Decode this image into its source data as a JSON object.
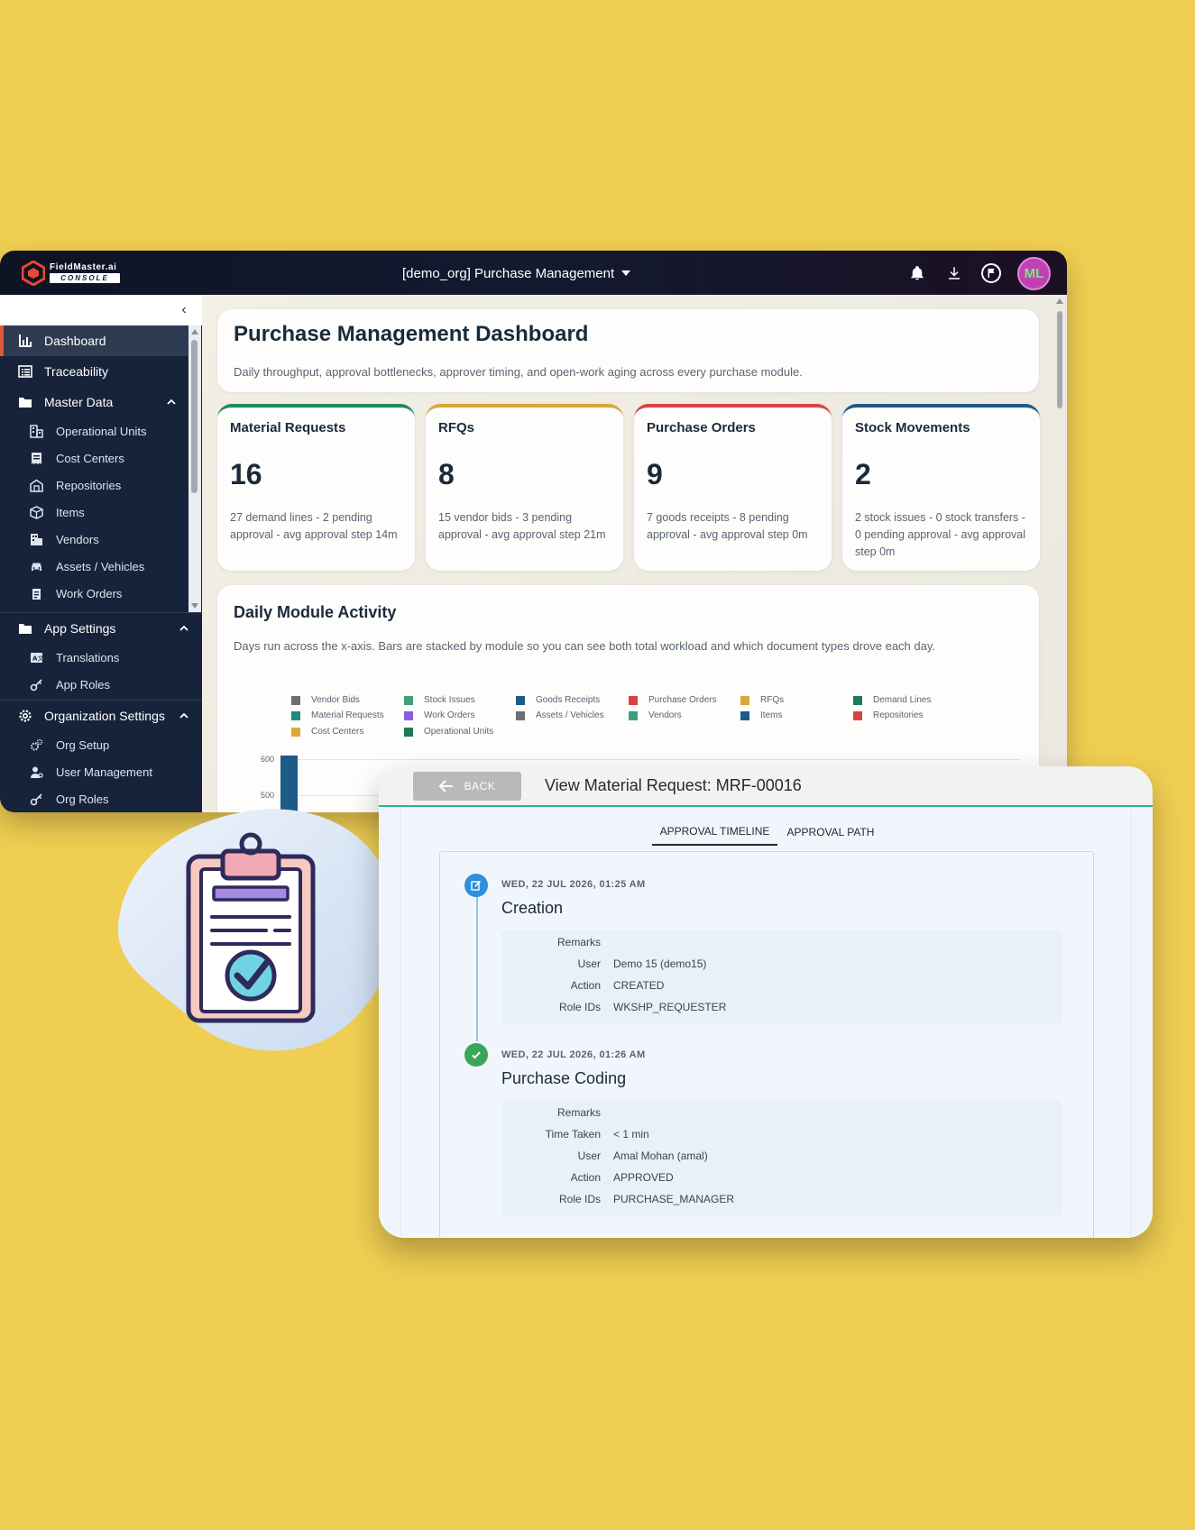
{
  "app": {
    "brand_line1": "FieldMaster.ai",
    "brand_line2": "CONSOLE",
    "module_selector": "[demo_org] Purchase Management",
    "user_initials": "ML"
  },
  "sidebar": {
    "items": [
      {
        "label": "Dashboard"
      },
      {
        "label": "Traceability"
      },
      {
        "label": "Master Data"
      }
    ],
    "master_data": [
      {
        "label": "Operational Units"
      },
      {
        "label": "Cost Centers"
      },
      {
        "label": "Repositories"
      },
      {
        "label": "Items"
      },
      {
        "label": "Vendors"
      },
      {
        "label": "Assets / Vehicles"
      },
      {
        "label": "Work Orders"
      }
    ],
    "app_settings": {
      "label": "App Settings",
      "items": [
        {
          "label": "Translations"
        },
        {
          "label": "App Roles"
        }
      ]
    },
    "org_settings": {
      "label": "Organization Settings",
      "items": [
        {
          "label": "Org Setup"
        },
        {
          "label": "User Management"
        },
        {
          "label": "Org Roles"
        }
      ]
    }
  },
  "dashboard": {
    "title": "Purchase Management Dashboard",
    "subtitle": "Daily throughput, approval bottlenecks, approver timing, and open-work aging across every purchase module.",
    "cards": [
      {
        "title": "Material Requests",
        "value": "16",
        "desc": "27 demand lines - 2 pending approval - avg approval step 14m",
        "color": "#1f8a66"
      },
      {
        "title": "RFQs",
        "value": "8",
        "desc": "15 vendor bids - 3 pending approval - avg approval step 21m",
        "color": "#d9a83a"
      },
      {
        "title": "Purchase Orders",
        "value": "9",
        "desc": "7 goods receipts - 8 pending approval - avg approval step 0m",
        "color": "#d64541"
      },
      {
        "title": "Stock Movements",
        "value": "2",
        "desc": "2 stock issues - 0 stock transfers - 0 pending approval - avg approval step 0m",
        "color": "#1c5b86"
      }
    ],
    "activity": {
      "title": "Daily Module Activity",
      "subtitle": "Days run across the x-axis. Bars are stacked by module so you can see both total workload and which document types drove each day."
    }
  },
  "chart_data": {
    "type": "bar",
    "stacked": true,
    "legend": [
      {
        "name": "Vendor Bids",
        "color": "#6b6f76"
      },
      {
        "name": "Stock Issues",
        "color": "#3fa07a"
      },
      {
        "name": "Goods Receipts",
        "color": "#1c5b86"
      },
      {
        "name": "Purchase Orders",
        "color": "#d64541"
      },
      {
        "name": "RFQs",
        "color": "#d9a83a"
      },
      {
        "name": "Demand Lines",
        "color": "#1f7a5c"
      },
      {
        "name": "Material Requests",
        "color": "#1f8a80"
      },
      {
        "name": "Work Orders",
        "color": "#8c5ce0"
      },
      {
        "name": "Assets / Vehicles",
        "color": "#6b6f76"
      },
      {
        "name": "Vendors",
        "color": "#3fa07a"
      },
      {
        "name": "Items",
        "color": "#1c5b86"
      },
      {
        "name": "Repositories",
        "color": "#d64541"
      },
      {
        "name": "Cost Centers",
        "color": "#d9a83a"
      },
      {
        "name": "Operational Units",
        "color": "#1f7a5c"
      }
    ],
    "y_ticks": [
      "600",
      "500"
    ]
  },
  "popup": {
    "back_label": "BACK",
    "title": "View Material Request: MRF-00016",
    "tabs": [
      "APPROVAL TIMELINE",
      "APPROVAL PATH"
    ],
    "timeline": [
      {
        "date": "WED, 22 JUL 2026, 01:25 AM",
        "step": "Creation",
        "rows": [
          {
            "k": "Remarks",
            "v": ""
          },
          {
            "k": "User",
            "v": "Demo 15 (demo15)"
          },
          {
            "k": "Action",
            "v": "CREATED"
          },
          {
            "k": "Role IDs",
            "v": "WKSHP_REQUESTER"
          }
        ]
      },
      {
        "date": "WED, 22 JUL 2026, 01:26 AM",
        "step": "Purchase Coding",
        "rows": [
          {
            "k": "Remarks",
            "v": ""
          },
          {
            "k": "Time Taken",
            "v": "< 1 min"
          },
          {
            "k": "User",
            "v": "Amal Mohan (amal)"
          },
          {
            "k": "Action",
            "v": "APPROVED"
          },
          {
            "k": "Role IDs",
            "v": "PURCHASE_MANAGER"
          }
        ]
      }
    ]
  }
}
